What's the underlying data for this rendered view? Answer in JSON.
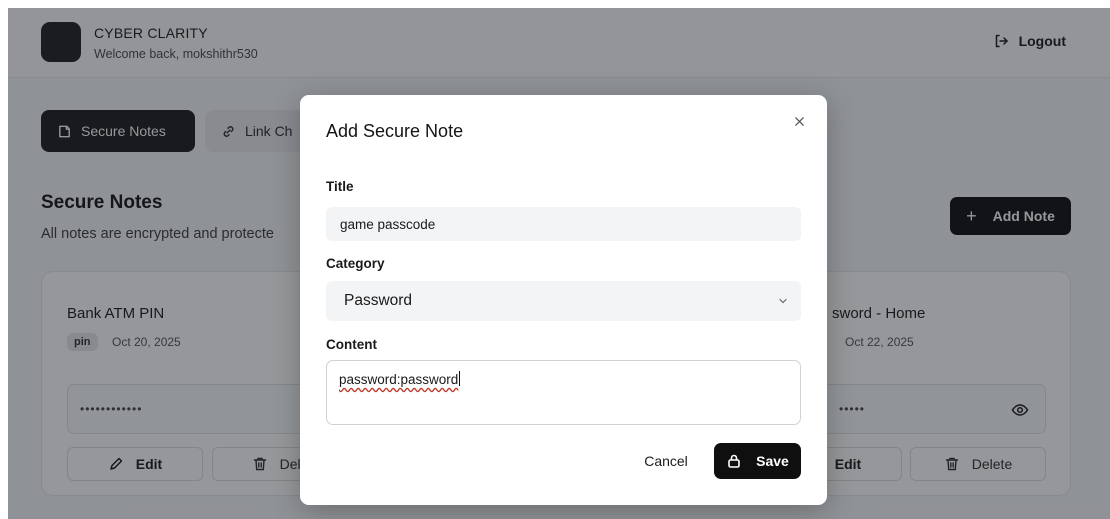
{
  "header": {
    "app_title": "CYBER CLARITY",
    "welcome": "Welcome back, mokshithr530",
    "logout_label": "Logout"
  },
  "tabs": [
    {
      "label": "Secure Notes",
      "icon": "note-icon",
      "active": true
    },
    {
      "label": "Link Ch",
      "icon": "link-icon",
      "active": false
    }
  ],
  "section": {
    "title": "Secure Notes",
    "subtitle": "All notes are encrypted and protecte",
    "add_button": "Add Note"
  },
  "cards": [
    {
      "title": "Bank ATM PIN",
      "badge": "pin",
      "date": "Oct 20, 2025",
      "secret": "••••••••••••",
      "edit_label": "Edit",
      "delete_label": "Dele"
    },
    {
      "title": "sword - Home",
      "badge": "",
      "date": "Oct 22, 2025",
      "secret": "•••••",
      "edit_label": "Edit",
      "delete_label": "Delete"
    }
  ],
  "modal": {
    "title": "Add Secure Note",
    "close_icon": "close-icon",
    "title_label": "Title",
    "title_value": "game passcode",
    "category_label": "Category",
    "category_value": "Password",
    "content_label": "Content",
    "content_value": "password:password",
    "cancel_label": "Cancel",
    "save_label": "Save"
  },
  "colors": {
    "primary": "#0f0f0f",
    "overlay": "#14182073",
    "surface": "#ffffff"
  }
}
